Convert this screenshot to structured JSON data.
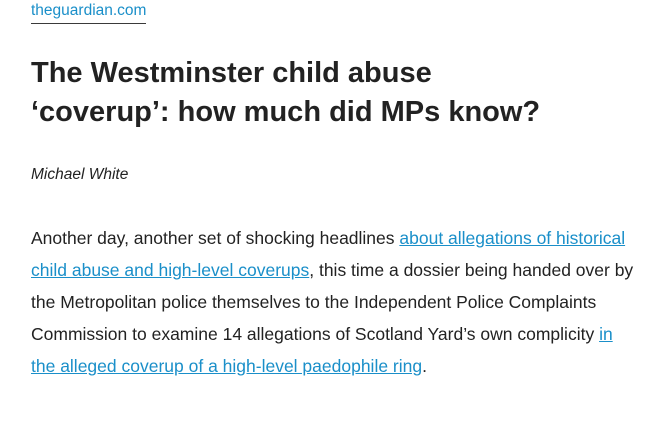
{
  "site": {
    "name": "theguardian.com"
  },
  "article": {
    "title_line1": "The Westminster child abuse",
    "title_line2": "‘coverup’: how much did MPs know?",
    "byline": "Michael White",
    "paragraph": {
      "text_1": "Another day, another set of shocking headlines ",
      "link_1": "about allegations of historical child abuse and high-level coverups",
      "text_2": ", this time a dossier being handed over by the Metropolitan police themselves to the Independent Police Complaints Commission to examine 14 allegations of Scotland Yard’s own complicity ",
      "link_2": "in the alleged coverup of a high-level paedophile ring",
      "text_3": "."
    }
  },
  "colors": {
    "link": "#1a8fc9",
    "text": "#222222"
  }
}
